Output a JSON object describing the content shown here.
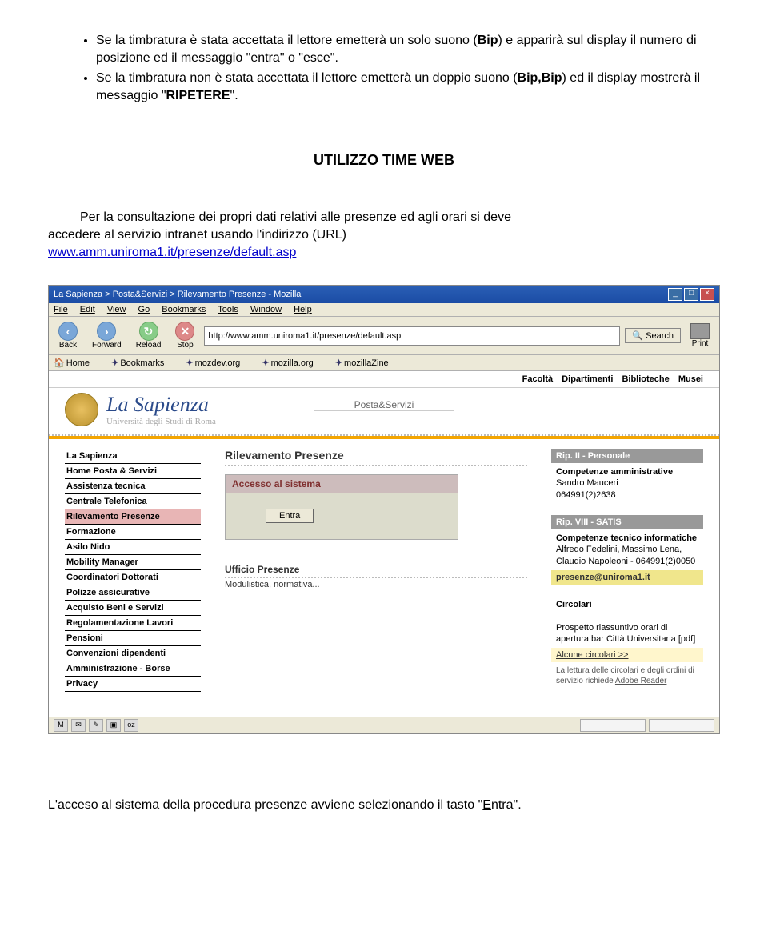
{
  "bullets": [
    {
      "pre": "Se la timbratura è stata accettata il lettore emetterà un solo suono (",
      "bold1": "Bip",
      "mid": ") e apparirà sul display il numero di posizione ed il messaggio \"entra\" o \"esce\"."
    },
    {
      "pre": "Se la timbratura non è stata accettata il lettore emetterà un doppio suono (",
      "bold1": "Bip,Bip",
      "mid": ") ed il display mostrerà il messaggio \"",
      "bold2": "RIPETERE",
      "post": "\"."
    }
  ],
  "section_title": "UTILIZZO TIME WEB",
  "intro": {
    "line1_indent": "Per la consultazione dei propri dati relativi alle presenze ed agli orari si deve",
    "line2": "accedere al servizio intranet usando l'indirizzo (URL)",
    "link": "www.amm.uniroma1.it/presenze/default.asp"
  },
  "browser": {
    "title": "La Sapienza > Posta&Servizi > Rilevamento Presenze - Mozilla",
    "menus": [
      "File",
      "Edit",
      "View",
      "Go",
      "Bookmarks",
      "Tools",
      "Window",
      "Help"
    ],
    "nav": {
      "back": "Back",
      "forward": "Forward",
      "reload": "Reload",
      "stop": "Stop",
      "search": "Search",
      "print": "Print"
    },
    "url": "http://www.amm.uniroma1.it/presenze/default.asp",
    "bookmarks": [
      "Home",
      "Bookmarks",
      "mozdev.org",
      "mozilla.org",
      "mozillaZine"
    ],
    "topnav": [
      "Facoltà",
      "Dipartimenti",
      "Biblioteche",
      "Musei"
    ],
    "logo_main": "La Sapienza",
    "logo_sub": "Università degli Studi di Roma",
    "header_tab": "Posta&Servizi",
    "sidebar": [
      "La Sapienza",
      "Home Posta & Servizi",
      "Assistenza tecnica",
      "Centrale Telefonica",
      "Rilevamento Presenze",
      "Formazione",
      "Asilo Nido",
      "Mobility Manager",
      "Coordinatori Dottorati",
      "Polizze assicurative",
      "Acquisto Beni e Servizi",
      "Regolamentazione Lavori",
      "Pensioni",
      "Convenzioni dipendenti",
      "Amministrazione - Borse",
      "Privacy"
    ],
    "active_sidebar_index": 4,
    "center_title": "Rilevamento Presenze",
    "access_title": "Accesso al sistema",
    "access_button": "Entra",
    "sub_title": "Ufficio Presenze",
    "sub_desc": "Modulistica, normativa...",
    "right": {
      "box1_hdr": "Rip. II - Personale",
      "box1_b1": "Competenze amministrative",
      "box1_txt": "Sandro Mauceri\n064991(2)2638",
      "box2_hdr": "Rip. VIII - SATIS",
      "box2_b1": "Competenze tecnico informatiche",
      "box2_txt": "Alfredo Fedelini, Massimo Lena, Claudio Napoleoni - 064991(2)0050",
      "box2_yellow": "presenze@uniroma1.it",
      "box3_hdr": "Circolari",
      "box3_txt": "Prospetto riassuntivo orari di apertura bar Città Universitaria [pdf]",
      "box3_more": "Alcune circolari >>",
      "box3_note_pre": "La lettura delle circolari e degli ordini di servizio richiede ",
      "box3_note_link": "Adobe Reader"
    }
  },
  "footer": {
    "pre": "L'acceso al sistema della procedura presenze avviene selezionando il tasto \"",
    "u": "E",
    "rest": "ntra\"."
  }
}
